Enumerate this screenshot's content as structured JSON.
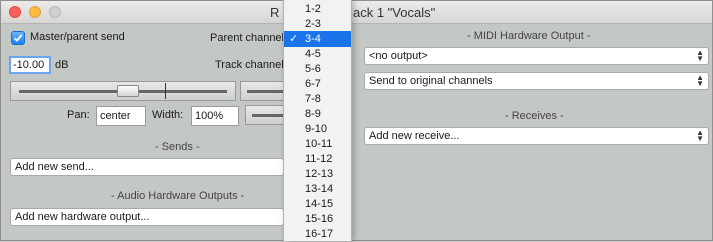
{
  "window": {
    "title_left": "R",
    "title_right": "ack 1 \"Vocals\""
  },
  "left": {
    "master_send_label": "Master/parent send",
    "master_send_checked": true,
    "parent_channel_label": "Parent channel",
    "volume_value": "-10.00",
    "volume_unit": "dB",
    "track_channels_label": "Track channels",
    "pan_label": "Pan:",
    "pan_value": "center",
    "width_label": "Width:",
    "width_value": "100%",
    "sends_section": "- Sends -",
    "add_send": "Add new send...",
    "hw_outputs_section": "- Audio Hardware Outputs -",
    "add_hw_output": "Add new hardware output..."
  },
  "right": {
    "midi_section": "- MIDI Hardware Output -",
    "midi_output": "<no output>",
    "midi_channels": "Send to original channels",
    "receives_section": "- Receives -",
    "add_receive": "Add new receive..."
  },
  "dropdown": {
    "items": [
      "1-2",
      "2-3",
      "3-4",
      "4-5",
      "5-6",
      "6-7",
      "7-8",
      "8-9",
      "9-10",
      "10-11",
      "11-12",
      "12-13",
      "13-14",
      "14-15",
      "15-16",
      "16-17"
    ],
    "selected": "3-4"
  },
  "colors": {
    "window_bg": "#c3c8c4",
    "selection": "#1a73e8",
    "close": "#fc605c",
    "minimize": "#fdbc40"
  }
}
